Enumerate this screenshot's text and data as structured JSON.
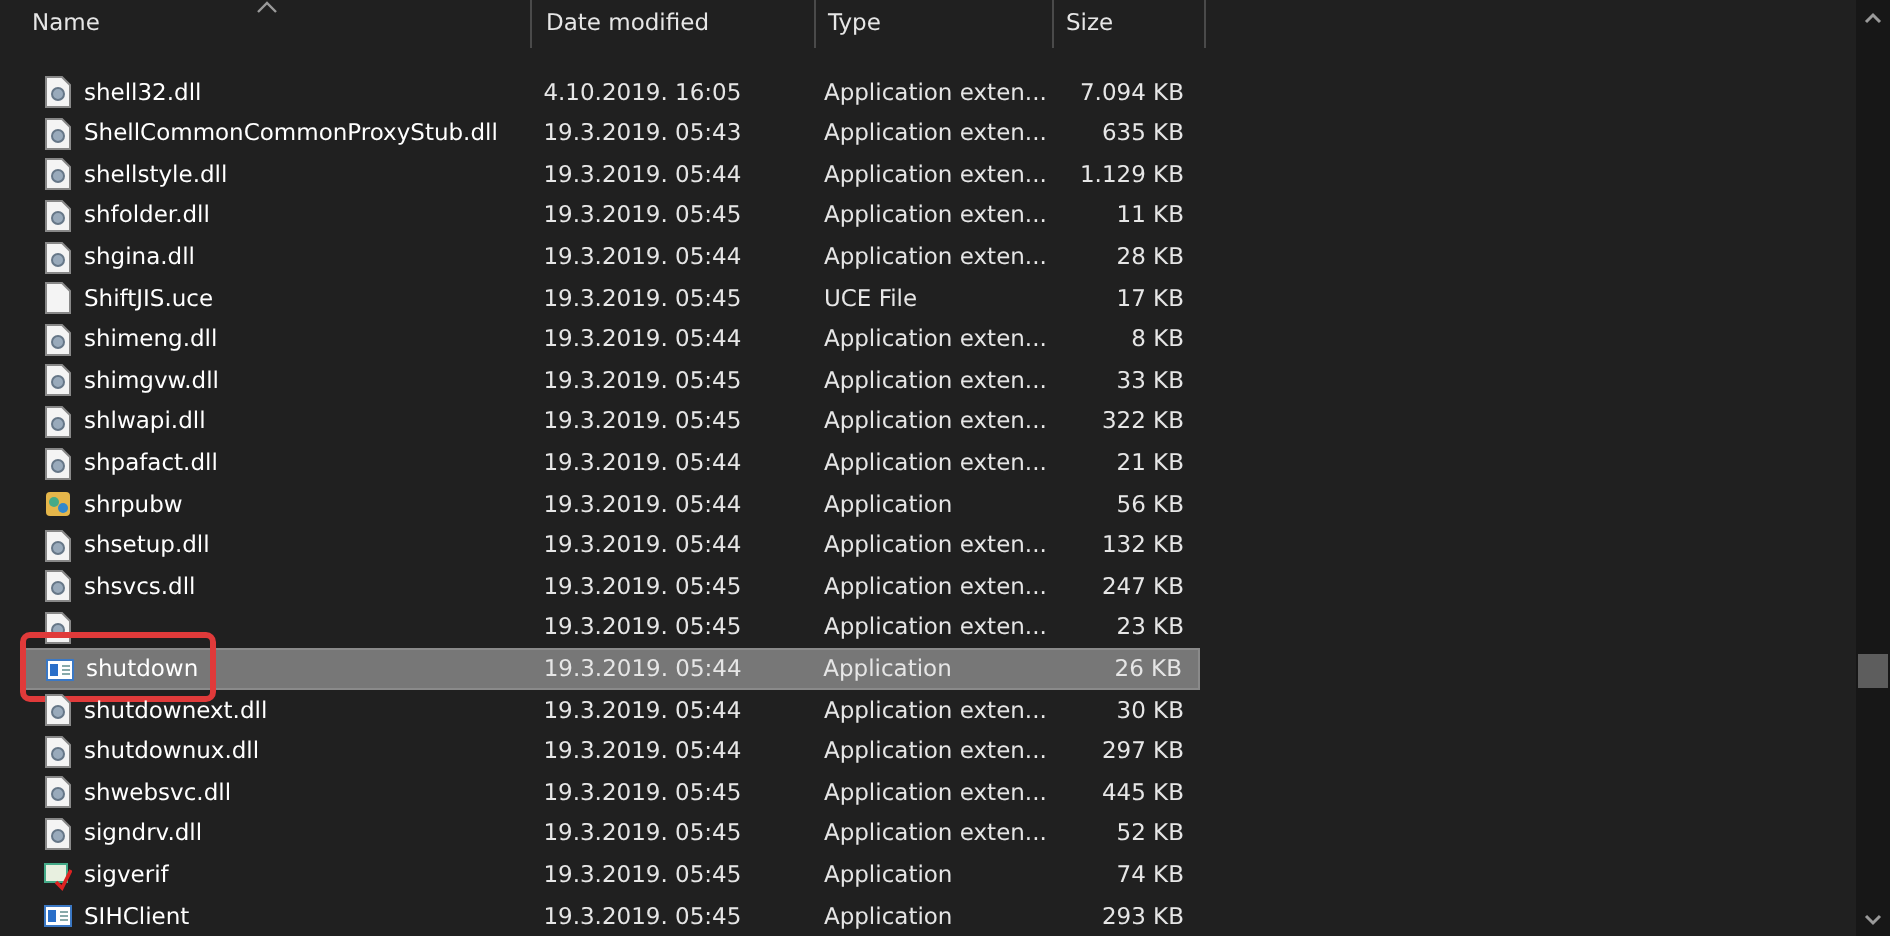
{
  "columns": [
    {
      "label": "Name",
      "sorted": true
    },
    {
      "label": "Date modified",
      "sorted": false
    },
    {
      "label": "Type",
      "sorted": false
    },
    {
      "label": "Size",
      "sorted": false
    }
  ],
  "rows": [
    {
      "kind": "dll",
      "name": "shell32.dll",
      "date": "4.10.2019. 16:05",
      "type": "Application exten...",
      "size": "7.094 KB",
      "selected": false,
      "annotated": false
    },
    {
      "kind": "dll",
      "name": "ShellCommonCommonProxyStub.dll",
      "date": "19.3.2019. 05:43",
      "type": "Application exten...",
      "size": "635 KB",
      "selected": false,
      "annotated": false
    },
    {
      "kind": "dll",
      "name": "shellstyle.dll",
      "date": "19.3.2019. 05:44",
      "type": "Application exten...",
      "size": "1.129 KB",
      "selected": false,
      "annotated": false
    },
    {
      "kind": "dll",
      "name": "shfolder.dll",
      "date": "19.3.2019. 05:45",
      "type": "Application exten...",
      "size": "11 KB",
      "selected": false,
      "annotated": false
    },
    {
      "kind": "dll",
      "name": "shgina.dll",
      "date": "19.3.2019. 05:44",
      "type": "Application exten...",
      "size": "28 KB",
      "selected": false,
      "annotated": false
    },
    {
      "kind": "file",
      "name": "ShiftJIS.uce",
      "date": "19.3.2019. 05:45",
      "type": "UCE File",
      "size": "17 KB",
      "selected": false,
      "annotated": false
    },
    {
      "kind": "dll",
      "name": "shimeng.dll",
      "date": "19.3.2019. 05:44",
      "type": "Application exten...",
      "size": "8 KB",
      "selected": false,
      "annotated": false
    },
    {
      "kind": "dll",
      "name": "shimgvw.dll",
      "date": "19.3.2019. 05:45",
      "type": "Application exten...",
      "size": "33 KB",
      "selected": false,
      "annotated": false
    },
    {
      "kind": "dll",
      "name": "shlwapi.dll",
      "date": "19.3.2019. 05:45",
      "type": "Application exten...",
      "size": "322 KB",
      "selected": false,
      "annotated": false
    },
    {
      "kind": "dll",
      "name": "shpafact.dll",
      "date": "19.3.2019. 05:44",
      "type": "Application exten...",
      "size": "21 KB",
      "selected": false,
      "annotated": false
    },
    {
      "kind": "setup",
      "name": "shrpubw",
      "date": "19.3.2019. 05:44",
      "type": "Application",
      "size": "56 KB",
      "selected": false,
      "annotated": false
    },
    {
      "kind": "dll",
      "name": "shsetup.dll",
      "date": "19.3.2019. 05:44",
      "type": "Application exten...",
      "size": "132 KB",
      "selected": false,
      "annotated": false
    },
    {
      "kind": "dll",
      "name": "shsvcs.dll",
      "date": "19.3.2019. 05:45",
      "type": "Application exten...",
      "size": "247 KB",
      "selected": false,
      "annotated": false
    },
    {
      "kind": "dll",
      "date": "19.3.2019. 05:45",
      "type": "Application exten...",
      "size": "23 KB",
      "selected": false,
      "annotated": false
    },
    {
      "kind": "app",
      "name": "shutdown",
      "date": "19.3.2019. 05:44",
      "type": "Application",
      "size": "26 KB",
      "selected": true,
      "annotated": true
    },
    {
      "kind": "dll",
      "name": "shutdownext.dll",
      "date": "19.3.2019. 05:44",
      "type": "Application exten...",
      "size": "30 KB",
      "selected": false,
      "annotated": false
    },
    {
      "kind": "dll",
      "name": "shutdownux.dll",
      "date": "19.3.2019. 05:44",
      "type": "Application exten...",
      "size": "297 KB",
      "selected": false,
      "annotated": false
    },
    {
      "kind": "dll",
      "name": "shwebsvc.dll",
      "date": "19.3.2019. 05:45",
      "type": "Application exten...",
      "size": "445 KB",
      "selected": false,
      "annotated": false
    },
    {
      "kind": "dll",
      "name": "signdrv.dll",
      "date": "19.3.2019. 05:45",
      "type": "Application exten...",
      "size": "52 KB",
      "selected": false,
      "annotated": false
    },
    {
      "kind": "check",
      "name": "sigverif",
      "date": "19.3.2019. 05:45",
      "type": "Application",
      "size": "74 KB",
      "selected": false,
      "annotated": false
    },
    {
      "kind": "app",
      "name": "SIHClient",
      "date": "19.3.2019. 05:45",
      "type": "Application",
      "size": "293 KB",
      "selected": false,
      "annotated": false
    }
  ]
}
